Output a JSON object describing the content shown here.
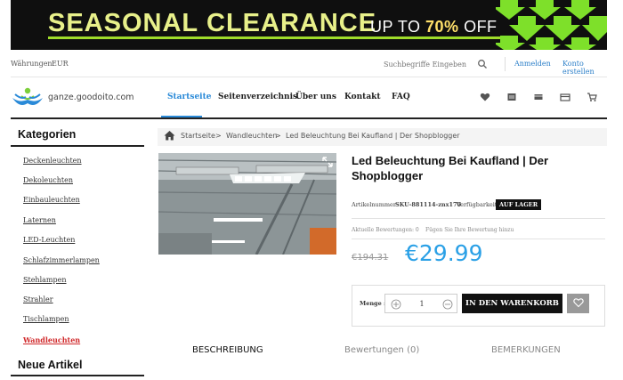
{
  "banner": {
    "word1": "SEASONAL",
    "word2": "CLEARANCE",
    "offer_prefix": "UP TO ",
    "offer_pct": "70%",
    "offer_suffix": " OFF"
  },
  "topbar": {
    "currency_label": "Währungen:",
    "currency_value": "EUR",
    "search_placeholder": "Suchbegriffe Eingeben",
    "login": "Anmelden",
    "register": "Konto erstellen"
  },
  "header": {
    "logo_text": "ganze.goodoito.com",
    "nav": [
      "Startseite",
      "Seitenverzeichnis",
      "Über uns",
      "Kontakt",
      "FAQ"
    ],
    "active_nav": "Startseite",
    "icons": [
      "heart-icon",
      "list-icon",
      "compare-icon",
      "card-icon",
      "cart-icon"
    ]
  },
  "sidebar": {
    "title": "Kategorien",
    "items": [
      "Deckenleuchten",
      "Dekoleuchten",
      "Einbauleuchten",
      "Laternen",
      "LED-Leuchten",
      "Schlafzimmerlampen",
      "Stehlampen",
      "Strahler",
      "Tischlampen",
      "Wandleuchten"
    ],
    "active_item": "Wandleuchten",
    "new_title": "Neue Artikel"
  },
  "breadcrumb": {
    "items": [
      "Startseite",
      "Wandleuchten",
      "Led Beleuchtung Bei Kaufland | Der Shopblogger"
    ],
    "separator": ">"
  },
  "product": {
    "title": "Led Beleuchtung Bei Kaufland | Der Shopblogger",
    "sku_label": "Artikelnummer:",
    "sku": "SKU-881114-znx170",
    "availability_label": "Verfügbarkeit:",
    "availability": "AUF LAGER",
    "reviews_text": "Aktuelle Bewertungen: 0",
    "review_link": "Fügen Sie Ihre Bewertung hinzu",
    "price_old": "€194.31",
    "price_new": "€29.99",
    "qty_label": "Menge :",
    "qty_value": "1",
    "add_to_cart": "IN DEN WARENKORB"
  },
  "tabs": [
    "BESCHREIBUNG",
    "Bewertungen (0)",
    "BEMERKUNGEN"
  ],
  "colors": {
    "accent": "#2a8ad8",
    "price": "#2aa0e6",
    "active_category": "#d0282a"
  }
}
